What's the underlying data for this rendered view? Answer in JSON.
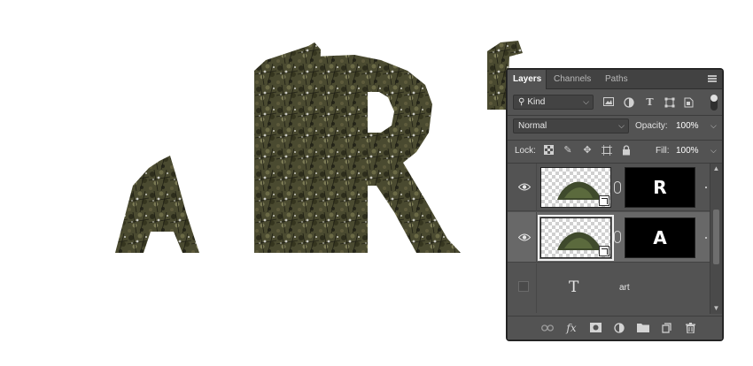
{
  "panel": {
    "tabs": [
      {
        "label": "Layers",
        "active": true
      },
      {
        "label": "Channels",
        "active": false
      },
      {
        "label": "Paths",
        "active": false
      }
    ],
    "filter": {
      "kind_label": "Kind"
    },
    "blend_mode": "Normal",
    "opacity_label": "Opacity:",
    "opacity_value": "100%",
    "lock_label": "Lock:",
    "fill_label": "Fill:",
    "fill_value": "100%",
    "layers": [
      {
        "visible": true,
        "selected": false,
        "mask_text": "R",
        "name": ""
      },
      {
        "visible": true,
        "selected": true,
        "mask_text": "A",
        "name": ""
      },
      {
        "visible": false,
        "selected": false,
        "type_icon": "T",
        "name": "art"
      }
    ]
  },
  "icons": {
    "search": "search-icon",
    "pixel_filter": "image-filter-icon",
    "adjustment_filter": "adjustment-filter-icon",
    "type_filter": "type-filter-icon",
    "shape_filter": "shape-filter-icon",
    "smart_filter": "smart-object-filter-icon",
    "eye": "eye-icon",
    "link": "link-icon",
    "fx": "fx-icon",
    "mask": "add-mask-icon",
    "adjustment": "new-adjustment-icon",
    "folder": "new-group-icon",
    "new_layer": "new-layer-icon",
    "trash": "trash-icon"
  },
  "colors": {
    "panel_bg": "#535353",
    "selected_row": "#686868",
    "foliage_dark": "#3a3a22",
    "foliage_mid": "#5c5a3a"
  }
}
